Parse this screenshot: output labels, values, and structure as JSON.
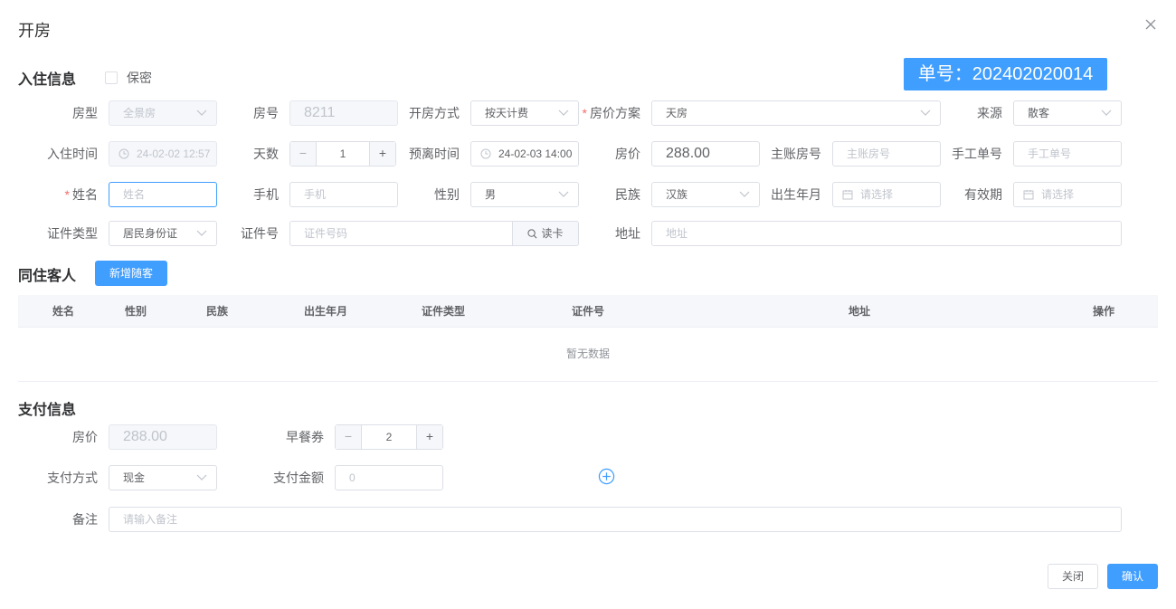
{
  "dialog": {
    "title": "开房"
  },
  "checkin": {
    "section_title": "入住信息",
    "confidential_label": "保密",
    "order_no": "单号：202402020014",
    "room_type": {
      "label": "房型",
      "value": "全景房"
    },
    "room_no": {
      "label": "房号",
      "value": "8211"
    },
    "open_mode": {
      "label": "开房方式",
      "value": "按天计费"
    },
    "price_plan": {
      "label": "房价方案",
      "value": "天房"
    },
    "source": {
      "label": "来源",
      "value": "散客"
    },
    "checkin_time": {
      "label": "入住时间",
      "value": "24-02-02 12:57"
    },
    "days": {
      "label": "天数",
      "value": "1",
      "minus": "−",
      "plus": "+"
    },
    "expected_leave": {
      "label": "预离时间",
      "value": "24-02-03 14:00"
    },
    "room_price": {
      "label": "房价",
      "value": "288.00"
    },
    "main_account": {
      "label": "主账房号",
      "placeholder": "主账房号"
    },
    "manual_no": {
      "label": "手工单号",
      "placeholder": "手工单号"
    },
    "name": {
      "label": "姓名",
      "placeholder": "姓名"
    },
    "phone": {
      "label": "手机",
      "placeholder": "手机"
    },
    "gender": {
      "label": "性别",
      "value": "男"
    },
    "ethnicity": {
      "label": "民族",
      "value": "汉族"
    },
    "birth": {
      "label": "出生年月",
      "placeholder": "请选择"
    },
    "validity": {
      "label": "有效期",
      "placeholder": "请选择"
    },
    "id_type": {
      "label": "证件类型",
      "value": "居民身份证"
    },
    "id_no": {
      "label": "证件号",
      "placeholder": "证件号码",
      "read_card": "读卡"
    },
    "address": {
      "label": "地址",
      "placeholder": "地址"
    }
  },
  "companions": {
    "section_title": "同住客人",
    "add_button": "新增随客",
    "columns": [
      "姓名",
      "性别",
      "民族",
      "出生年月",
      "证件类型",
      "证件号",
      "地址",
      "操作"
    ],
    "empty_text": "暂无数据"
  },
  "payment": {
    "section_title": "支付信息",
    "room_price": {
      "label": "房价",
      "value": "288.00"
    },
    "breakfast": {
      "label": "早餐券",
      "value": "2",
      "minus": "−",
      "plus": "+"
    },
    "pay_method": {
      "label": "支付方式",
      "value": "现金"
    },
    "pay_amount": {
      "label": "支付金额",
      "placeholder": "0"
    },
    "remark": {
      "label": "备注",
      "placeholder": "请输入备注"
    }
  },
  "footer": {
    "close": "关闭",
    "confirm": "确认"
  },
  "colors": {
    "primary": "#409eff",
    "required": "#f56c6c"
  },
  "icons": [
    "close-icon",
    "chevron-down-icon",
    "clock-icon",
    "calendar-icon",
    "search-icon",
    "add-circle-icon"
  ]
}
